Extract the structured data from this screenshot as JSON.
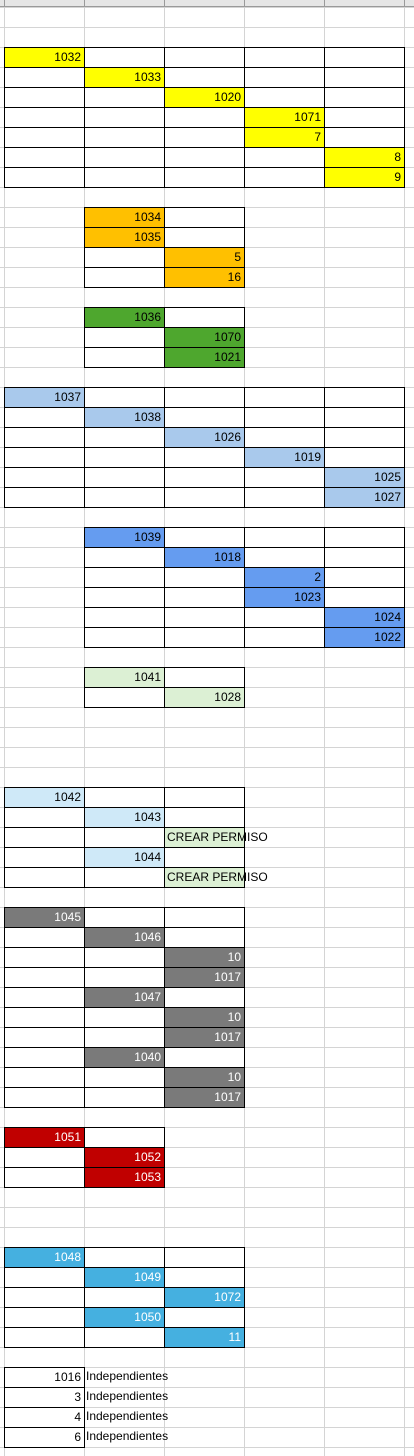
{
  "sheet": {
    "columns": [
      "A",
      "B",
      "C",
      "D",
      "E"
    ],
    "colors": {
      "yellow": "#ffff00",
      "orange": "#ffc000",
      "green": "#4ea72e",
      "light_blue": "#a9c9ec",
      "blue": "#659cf0",
      "light_green": "#dcf0d4",
      "pale_blue": "#cfe9f8",
      "gray": "#7a7a7a",
      "red": "#c00000",
      "sky_blue": "#45b0e0",
      "white": "#ffffff"
    },
    "cells": [
      {
        "row": 2,
        "col": 0,
        "value": "1032",
        "fill": "yellow"
      },
      {
        "row": 2,
        "col": 1,
        "value": "",
        "fill": "white"
      },
      {
        "row": 2,
        "col": 2,
        "value": "",
        "fill": "white"
      },
      {
        "row": 2,
        "col": 3,
        "value": "",
        "fill": "white"
      },
      {
        "row": 2,
        "col": 4,
        "value": "",
        "fill": "white"
      },
      {
        "row": 3,
        "col": 0,
        "value": "",
        "fill": "white"
      },
      {
        "row": 3,
        "col": 1,
        "value": "1033",
        "fill": "yellow"
      },
      {
        "row": 3,
        "col": 2,
        "value": "",
        "fill": "white"
      },
      {
        "row": 3,
        "col": 3,
        "value": "",
        "fill": "white"
      },
      {
        "row": 3,
        "col": 4,
        "value": "",
        "fill": "white"
      },
      {
        "row": 4,
        "col": 0,
        "value": "",
        "fill": "white"
      },
      {
        "row": 4,
        "col": 1,
        "value": "",
        "fill": "white"
      },
      {
        "row": 4,
        "col": 2,
        "value": "1020",
        "fill": "yellow"
      },
      {
        "row": 4,
        "col": 3,
        "value": "",
        "fill": "white"
      },
      {
        "row": 4,
        "col": 4,
        "value": "",
        "fill": "white"
      },
      {
        "row": 5,
        "col": 0,
        "value": "",
        "fill": "white"
      },
      {
        "row": 5,
        "col": 1,
        "value": "",
        "fill": "white"
      },
      {
        "row": 5,
        "col": 2,
        "value": "",
        "fill": "white"
      },
      {
        "row": 5,
        "col": 3,
        "value": "1071",
        "fill": "yellow"
      },
      {
        "row": 5,
        "col": 4,
        "value": "",
        "fill": "white"
      },
      {
        "row": 6,
        "col": 0,
        "value": "",
        "fill": "white"
      },
      {
        "row": 6,
        "col": 1,
        "value": "",
        "fill": "white"
      },
      {
        "row": 6,
        "col": 2,
        "value": "",
        "fill": "white"
      },
      {
        "row": 6,
        "col": 3,
        "value": "7",
        "fill": "yellow"
      },
      {
        "row": 6,
        "col": 4,
        "value": "",
        "fill": "white"
      },
      {
        "row": 7,
        "col": 0,
        "value": "",
        "fill": "white"
      },
      {
        "row": 7,
        "col": 1,
        "value": "",
        "fill": "white"
      },
      {
        "row": 7,
        "col": 2,
        "value": "",
        "fill": "white"
      },
      {
        "row": 7,
        "col": 3,
        "value": "",
        "fill": "white"
      },
      {
        "row": 7,
        "col": 4,
        "value": "8",
        "fill": "yellow"
      },
      {
        "row": 8,
        "col": 0,
        "value": "",
        "fill": "white"
      },
      {
        "row": 8,
        "col": 1,
        "value": "",
        "fill": "white"
      },
      {
        "row": 8,
        "col": 2,
        "value": "",
        "fill": "white"
      },
      {
        "row": 8,
        "col": 3,
        "value": "",
        "fill": "white"
      },
      {
        "row": 8,
        "col": 4,
        "value": "9",
        "fill": "yellow"
      },
      {
        "row": 10,
        "col": 1,
        "value": "1034",
        "fill": "orange"
      },
      {
        "row": 10,
        "col": 2,
        "value": "",
        "fill": "white"
      },
      {
        "row": 11,
        "col": 1,
        "value": "1035",
        "fill": "orange"
      },
      {
        "row": 11,
        "col": 2,
        "value": "",
        "fill": "white"
      },
      {
        "row": 12,
        "col": 1,
        "value": "",
        "fill": "white"
      },
      {
        "row": 12,
        "col": 2,
        "value": "5",
        "fill": "orange"
      },
      {
        "row": 13,
        "col": 1,
        "value": "",
        "fill": "white"
      },
      {
        "row": 13,
        "col": 2,
        "value": "16",
        "fill": "orange"
      },
      {
        "row": 15,
        "col": 1,
        "value": "1036",
        "fill": "green"
      },
      {
        "row": 15,
        "col": 2,
        "value": "",
        "fill": "white"
      },
      {
        "row": 16,
        "col": 1,
        "value": "",
        "fill": "white"
      },
      {
        "row": 16,
        "col": 2,
        "value": "1070",
        "fill": "green"
      },
      {
        "row": 17,
        "col": 1,
        "value": "",
        "fill": "white"
      },
      {
        "row": 17,
        "col": 2,
        "value": "1021",
        "fill": "green"
      },
      {
        "row": 19,
        "col": 0,
        "value": "1037",
        "fill": "light_blue"
      },
      {
        "row": 19,
        "col": 1,
        "value": "",
        "fill": "white"
      },
      {
        "row": 19,
        "col": 2,
        "value": "",
        "fill": "white"
      },
      {
        "row": 19,
        "col": 3,
        "value": "",
        "fill": "white"
      },
      {
        "row": 19,
        "col": 4,
        "value": "",
        "fill": "white"
      },
      {
        "row": 20,
        "col": 0,
        "value": "",
        "fill": "white"
      },
      {
        "row": 20,
        "col": 1,
        "value": "1038",
        "fill": "light_blue"
      },
      {
        "row": 20,
        "col": 2,
        "value": "",
        "fill": "white"
      },
      {
        "row": 20,
        "col": 3,
        "value": "",
        "fill": "white"
      },
      {
        "row": 20,
        "col": 4,
        "value": "",
        "fill": "white"
      },
      {
        "row": 21,
        "col": 0,
        "value": "",
        "fill": "white"
      },
      {
        "row": 21,
        "col": 1,
        "value": "",
        "fill": "white"
      },
      {
        "row": 21,
        "col": 2,
        "value": "1026",
        "fill": "light_blue"
      },
      {
        "row": 21,
        "col": 3,
        "value": "",
        "fill": "white"
      },
      {
        "row": 21,
        "col": 4,
        "value": "",
        "fill": "white"
      },
      {
        "row": 22,
        "col": 0,
        "value": "",
        "fill": "white"
      },
      {
        "row": 22,
        "col": 1,
        "value": "",
        "fill": "white"
      },
      {
        "row": 22,
        "col": 2,
        "value": "",
        "fill": "white"
      },
      {
        "row": 22,
        "col": 3,
        "value": "1019",
        "fill": "light_blue"
      },
      {
        "row": 22,
        "col": 4,
        "value": "",
        "fill": "white"
      },
      {
        "row": 23,
        "col": 0,
        "value": "",
        "fill": "white"
      },
      {
        "row": 23,
        "col": 1,
        "value": "",
        "fill": "white"
      },
      {
        "row": 23,
        "col": 2,
        "value": "",
        "fill": "white"
      },
      {
        "row": 23,
        "col": 3,
        "value": "",
        "fill": "white"
      },
      {
        "row": 23,
        "col": 4,
        "value": "1025",
        "fill": "light_blue"
      },
      {
        "row": 24,
        "col": 0,
        "value": "",
        "fill": "white"
      },
      {
        "row": 24,
        "col": 1,
        "value": "",
        "fill": "white"
      },
      {
        "row": 24,
        "col": 2,
        "value": "",
        "fill": "white"
      },
      {
        "row": 24,
        "col": 3,
        "value": "",
        "fill": "white"
      },
      {
        "row": 24,
        "col": 4,
        "value": "1027",
        "fill": "light_blue"
      },
      {
        "row": 26,
        "col": 1,
        "value": "1039",
        "fill": "blue"
      },
      {
        "row": 26,
        "col": 2,
        "value": "",
        "fill": "white"
      },
      {
        "row": 26,
        "col": 3,
        "value": "",
        "fill": "white"
      },
      {
        "row": 26,
        "col": 4,
        "value": "",
        "fill": "white"
      },
      {
        "row": 27,
        "col": 1,
        "value": "",
        "fill": "white"
      },
      {
        "row": 27,
        "col": 2,
        "value": "1018",
        "fill": "blue"
      },
      {
        "row": 27,
        "col": 3,
        "value": "",
        "fill": "white"
      },
      {
        "row": 27,
        "col": 4,
        "value": "",
        "fill": "white"
      },
      {
        "row": 28,
        "col": 1,
        "value": "",
        "fill": "white"
      },
      {
        "row": 28,
        "col": 2,
        "value": "",
        "fill": "white"
      },
      {
        "row": 28,
        "col": 3,
        "value": "2",
        "fill": "blue"
      },
      {
        "row": 28,
        "col": 4,
        "value": "",
        "fill": "white"
      },
      {
        "row": 29,
        "col": 1,
        "value": "",
        "fill": "white"
      },
      {
        "row": 29,
        "col": 2,
        "value": "",
        "fill": "white"
      },
      {
        "row": 29,
        "col": 3,
        "value": "1023",
        "fill": "blue"
      },
      {
        "row": 29,
        "col": 4,
        "value": "",
        "fill": "white"
      },
      {
        "row": 30,
        "col": 1,
        "value": "",
        "fill": "white"
      },
      {
        "row": 30,
        "col": 2,
        "value": "",
        "fill": "white"
      },
      {
        "row": 30,
        "col": 3,
        "value": "",
        "fill": "white"
      },
      {
        "row": 30,
        "col": 4,
        "value": "1024",
        "fill": "blue"
      },
      {
        "row": 31,
        "col": 1,
        "value": "",
        "fill": "white"
      },
      {
        "row": 31,
        "col": 2,
        "value": "",
        "fill": "white"
      },
      {
        "row": 31,
        "col": 3,
        "value": "",
        "fill": "white"
      },
      {
        "row": 31,
        "col": 4,
        "value": "1022",
        "fill": "blue"
      },
      {
        "row": 33,
        "col": 1,
        "value": "1041",
        "fill": "light_green"
      },
      {
        "row": 33,
        "col": 2,
        "value": "",
        "fill": "white"
      },
      {
        "row": 34,
        "col": 1,
        "value": "",
        "fill": "white"
      },
      {
        "row": 34,
        "col": 2,
        "value": "1028",
        "fill": "light_green"
      },
      {
        "row": 39,
        "col": 0,
        "value": "1042",
        "fill": "pale_blue"
      },
      {
        "row": 39,
        "col": 1,
        "value": "",
        "fill": "white"
      },
      {
        "row": 39,
        "col": 2,
        "value": "",
        "fill": "white"
      },
      {
        "row": 40,
        "col": 0,
        "value": "",
        "fill": "white"
      },
      {
        "row": 40,
        "col": 1,
        "value": "1043",
        "fill": "pale_blue"
      },
      {
        "row": 40,
        "col": 2,
        "value": "",
        "fill": "white"
      },
      {
        "row": 41,
        "col": 0,
        "value": "",
        "fill": "white"
      },
      {
        "row": 41,
        "col": 1,
        "value": "",
        "fill": "white"
      },
      {
        "row": 41,
        "col": 2,
        "value": "CREAR PERMISO",
        "fill": "light_green",
        "text": true
      },
      {
        "row": 42,
        "col": 0,
        "value": "",
        "fill": "white"
      },
      {
        "row": 42,
        "col": 1,
        "value": "1044",
        "fill": "pale_blue"
      },
      {
        "row": 42,
        "col": 2,
        "value": "",
        "fill": "white"
      },
      {
        "row": 43,
        "col": 0,
        "value": "",
        "fill": "white"
      },
      {
        "row": 43,
        "col": 1,
        "value": "",
        "fill": "white"
      },
      {
        "row": 43,
        "col": 2,
        "value": "CREAR PERMISO",
        "fill": "light_green",
        "text": true
      },
      {
        "row": 45,
        "col": 0,
        "value": "1045",
        "fill": "gray",
        "white_text": true
      },
      {
        "row": 45,
        "col": 1,
        "value": "",
        "fill": "white"
      },
      {
        "row": 45,
        "col": 2,
        "value": "",
        "fill": "white"
      },
      {
        "row": 46,
        "col": 0,
        "value": "",
        "fill": "white"
      },
      {
        "row": 46,
        "col": 1,
        "value": "1046",
        "fill": "gray",
        "white_text": true
      },
      {
        "row": 46,
        "col": 2,
        "value": "",
        "fill": "white"
      },
      {
        "row": 47,
        "col": 0,
        "value": "",
        "fill": "white"
      },
      {
        "row": 47,
        "col": 1,
        "value": "",
        "fill": "white"
      },
      {
        "row": 47,
        "col": 2,
        "value": "10",
        "fill": "gray",
        "white_text": true
      },
      {
        "row": 48,
        "col": 0,
        "value": "",
        "fill": "white"
      },
      {
        "row": 48,
        "col": 1,
        "value": "",
        "fill": "white"
      },
      {
        "row": 48,
        "col": 2,
        "value": "1017",
        "fill": "gray",
        "white_text": true
      },
      {
        "row": 49,
        "col": 0,
        "value": "",
        "fill": "white"
      },
      {
        "row": 49,
        "col": 1,
        "value": "1047",
        "fill": "gray",
        "white_text": true
      },
      {
        "row": 49,
        "col": 2,
        "value": "",
        "fill": "white"
      },
      {
        "row": 50,
        "col": 0,
        "value": "",
        "fill": "white"
      },
      {
        "row": 50,
        "col": 1,
        "value": "",
        "fill": "white"
      },
      {
        "row": 50,
        "col": 2,
        "value": "10",
        "fill": "gray",
        "white_text": true
      },
      {
        "row": 51,
        "col": 0,
        "value": "",
        "fill": "white"
      },
      {
        "row": 51,
        "col": 1,
        "value": "",
        "fill": "white"
      },
      {
        "row": 51,
        "col": 2,
        "value": "1017",
        "fill": "gray",
        "white_text": true
      },
      {
        "row": 52,
        "col": 0,
        "value": "",
        "fill": "white"
      },
      {
        "row": 52,
        "col": 1,
        "value": "1040",
        "fill": "gray",
        "white_text": true
      },
      {
        "row": 52,
        "col": 2,
        "value": "",
        "fill": "white"
      },
      {
        "row": 53,
        "col": 0,
        "value": "",
        "fill": "white"
      },
      {
        "row": 53,
        "col": 1,
        "value": "",
        "fill": "white"
      },
      {
        "row": 53,
        "col": 2,
        "value": "10",
        "fill": "gray",
        "white_text": true
      },
      {
        "row": 54,
        "col": 0,
        "value": "",
        "fill": "white"
      },
      {
        "row": 54,
        "col": 1,
        "value": "",
        "fill": "white"
      },
      {
        "row": 54,
        "col": 2,
        "value": "1017",
        "fill": "gray",
        "white_text": true
      },
      {
        "row": 56,
        "col": 0,
        "value": "1051",
        "fill": "red",
        "white_text": true
      },
      {
        "row": 56,
        "col": 1,
        "value": "",
        "fill": "white"
      },
      {
        "row": 57,
        "col": 0,
        "value": "",
        "fill": "white"
      },
      {
        "row": 57,
        "col": 1,
        "value": "1052",
        "fill": "red",
        "white_text": true
      },
      {
        "row": 58,
        "col": 0,
        "value": "",
        "fill": "white"
      },
      {
        "row": 58,
        "col": 1,
        "value": "1053",
        "fill": "red",
        "white_text": true
      },
      {
        "row": 62,
        "col": 0,
        "value": "1048",
        "fill": "sky_blue",
        "white_text": true
      },
      {
        "row": 62,
        "col": 1,
        "value": "",
        "fill": "white"
      },
      {
        "row": 62,
        "col": 2,
        "value": "",
        "fill": "white"
      },
      {
        "row": 63,
        "col": 0,
        "value": "",
        "fill": "white"
      },
      {
        "row": 63,
        "col": 1,
        "value": "1049",
        "fill": "sky_blue",
        "white_text": true
      },
      {
        "row": 63,
        "col": 2,
        "value": "",
        "fill": "white"
      },
      {
        "row": 64,
        "col": 0,
        "value": "",
        "fill": "white"
      },
      {
        "row": 64,
        "col": 1,
        "value": "",
        "fill": "white"
      },
      {
        "row": 64,
        "col": 2,
        "value": "1072",
        "fill": "sky_blue",
        "white_text": true
      },
      {
        "row": 65,
        "col": 0,
        "value": "",
        "fill": "white"
      },
      {
        "row": 65,
        "col": 1,
        "value": "1050",
        "fill": "sky_blue",
        "white_text": true
      },
      {
        "row": 65,
        "col": 2,
        "value": "",
        "fill": "white"
      },
      {
        "row": 66,
        "col": 0,
        "value": "",
        "fill": "white"
      },
      {
        "row": 66,
        "col": 1,
        "value": "",
        "fill": "white"
      },
      {
        "row": 66,
        "col": 2,
        "value": "11",
        "fill": "sky_blue",
        "white_text": true
      },
      {
        "row": 68,
        "col": 0,
        "value": "1016",
        "fill": "white"
      },
      {
        "row": 68,
        "col": 1,
        "value": "Independientes",
        "fill": "white",
        "text": true,
        "noborder": true
      },
      {
        "row": 69,
        "col": 0,
        "value": "3",
        "fill": "white"
      },
      {
        "row": 69,
        "col": 1,
        "value": "Independientes",
        "fill": "white",
        "text": true,
        "noborder": true
      },
      {
        "row": 70,
        "col": 0,
        "value": "4",
        "fill": "white"
      },
      {
        "row": 70,
        "col": 1,
        "value": "Independientes",
        "fill": "white",
        "text": true,
        "noborder": true
      },
      {
        "row": 71,
        "col": 0,
        "value": "6",
        "fill": "white"
      },
      {
        "row": 71,
        "col": 1,
        "value": "Independientes",
        "fill": "white",
        "text": true,
        "noborder": true
      }
    ]
  }
}
